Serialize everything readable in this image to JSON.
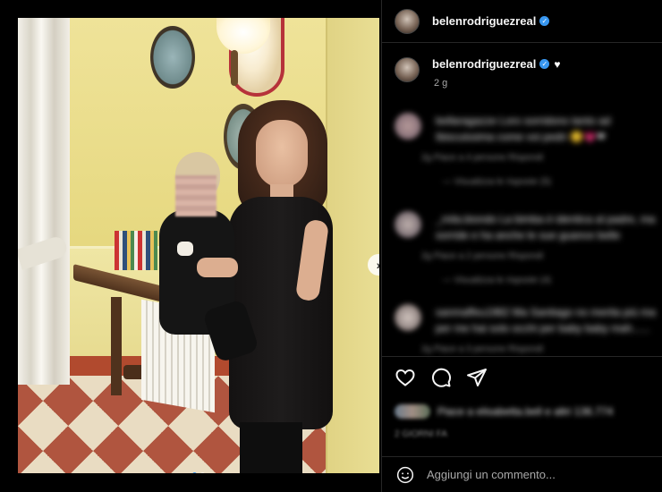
{
  "post": {
    "username": "belenrodriguezreal",
    "verified_icon": "verified-badge-icon",
    "caption_emoji": "♥",
    "age": "2 g",
    "carousel": {
      "total": 2,
      "current": 1
    }
  },
  "comments": [
    {
      "text": "bellaragazze Loro sorridono tanto ad Ibiscuissima come voi pedri 😊💗❤",
      "meta": "2g   Piace a 4 persone   Rispondi",
      "replies": "—   Visualizza le risposte (5)"
    },
    {
      "text": "_mila.biondo  La bimba è identica al padre, ma sorride e ha anche le sue guance belle bellissime",
      "meta": "2g   Piace a 2 persone   Rispondi",
      "replies": "—   Visualizza le risposte (4)"
    },
    {
      "text": "sanmaffeu1982 Ma Santiago no merita più ma per me hai solo occhi per baby baby mah......",
      "meta": "2g   Piace a 3 persone   Rispondi",
      "replies": ""
    }
  ],
  "likes": {
    "text": "Piace a elisabetta.bell e altri 136.774"
  },
  "date": "2 GIORNI FA",
  "comment_box": {
    "placeholder": "Aggiungi un commento..."
  },
  "colors": {
    "accent": "#3897f0",
    "background": "#000000",
    "divider": "#262626"
  }
}
